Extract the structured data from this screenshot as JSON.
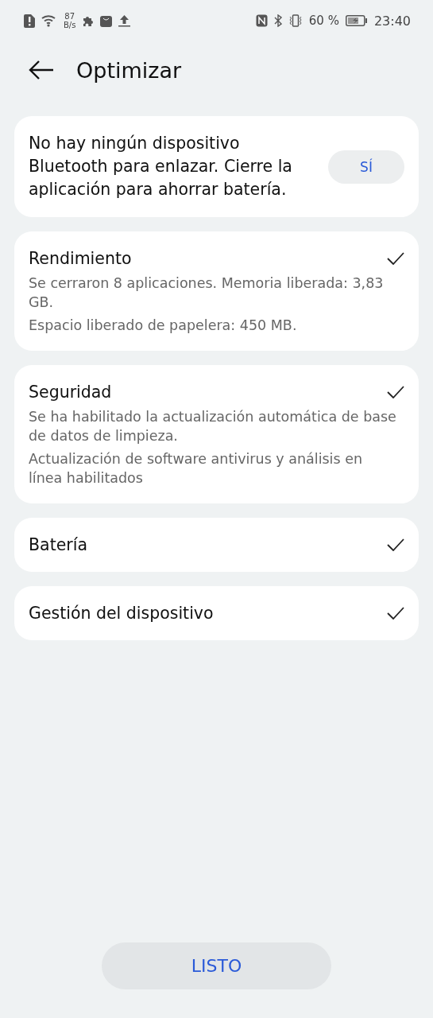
{
  "status_bar": {
    "net_speed": "87",
    "net_unit": "B/s",
    "battery": "60 %",
    "time": "23:40"
  },
  "header": {
    "title": "Optimizar"
  },
  "prompt": {
    "text": "No hay ningún dispositivo Bluetooth para enlazar. Cierre la aplicación para ahorrar batería.",
    "button": "SÍ"
  },
  "sections": [
    {
      "title": "Rendimiento",
      "checked": true,
      "details": [
        "Se cerraron 8 aplicaciones. Memoria liberada: 3,83 GB.",
        "Espacio liberado de papelera: 450 MB."
      ]
    },
    {
      "title": "Seguridad",
      "checked": true,
      "details": [
        "Se ha habilitado la actualización automática de base de datos de limpieza.",
        "Actualización de software antivirus y análisis en línea habilitados"
      ]
    },
    {
      "title": "Batería",
      "checked": true
    },
    {
      "title": "Gestión del dispositivo",
      "checked": true
    }
  ],
  "done_button": "LISTO"
}
